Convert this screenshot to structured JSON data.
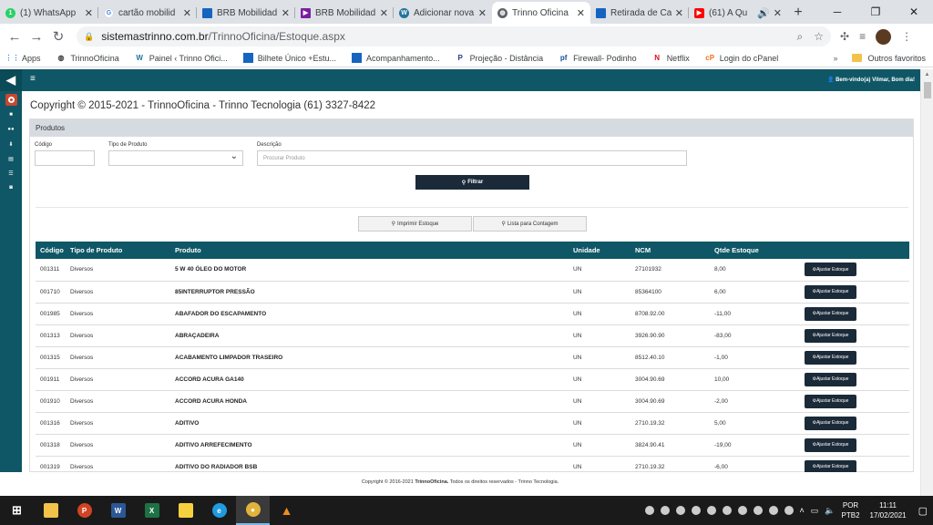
{
  "browser": {
    "tabs": [
      {
        "title": "(1) WhatsApp",
        "icon": "whatsapp-icon",
        "color": "#25d366"
      },
      {
        "title": "cartão mobilid",
        "icon": "google-icon",
        "color": "#4285f4"
      },
      {
        "title": "BRB Mobilidad",
        "icon": "brb-icon",
        "color": "#1565c0"
      },
      {
        "title": "BRB Mobilidad",
        "icon": "play-icon",
        "color": "#7b1fa2"
      },
      {
        "title": "Adicionar nova",
        "icon": "wordpress-icon",
        "color": "#21759b"
      },
      {
        "title": "Trinno Oficina",
        "icon": "globe-icon",
        "color": "#5f6368",
        "active": true
      },
      {
        "title": "Retirada de Ca",
        "icon": "brb-icon",
        "color": "#1565c0"
      },
      {
        "title": "(61) A Qu",
        "icon": "youtube-icon",
        "color": "#ff0000"
      }
    ],
    "url": {
      "host": "sistemastrinno.com.br",
      "path": "/TrinnoOficina/Estoque.aspx"
    },
    "bookmarks": [
      {
        "label": "Apps",
        "icon": "apps-grid-icon"
      },
      {
        "label": "TrinnoOficina",
        "icon": "globe-icon"
      },
      {
        "label": "Painel ‹ Trinno Ofici...",
        "icon": "wordpress-icon"
      },
      {
        "label": "Bilhete Único +Estu...",
        "icon": "brb-icon"
      },
      {
        "label": "Acompanhamento...",
        "icon": "brb-icon"
      },
      {
        "label": "Projeção - Distância",
        "icon": "p-icon"
      },
      {
        "label": "Firewall- Podinho",
        "icon": "pf-icon"
      },
      {
        "label": "Netflix",
        "icon": "netflix-icon"
      },
      {
        "label": "Login do cPanel",
        "icon": "cpanel-icon"
      }
    ],
    "other_bookmarks": "Outros favoritos"
  },
  "header": {
    "welcome": "Bem-vindo(a) Vilmar, Bom dia!"
  },
  "page": {
    "copyright": "Copyright © 2015-2021 - TrinnoOficina - Trinno Tecnologia (61) 3327-8422",
    "panel_title": "Produtos",
    "filters": {
      "codigo_label": "Código",
      "tipo_label": "Tipo de Produto",
      "descricao_label": "Descrição",
      "descricao_placeholder": "Procurar Produto",
      "filter_button": "Filtrar"
    },
    "buttons": {
      "print": "Imprimir Estoque",
      "count_list": "Lista para Contagem"
    },
    "table": {
      "headers": [
        "Código",
        "Tipo de Produto",
        "Produto",
        "Unidade",
        "NCM",
        "Qtde Estoque"
      ],
      "adjust_label": "Ajustar Estoque",
      "rows": [
        {
          "codigo": "001311",
          "tipo": "Diversos",
          "produto": "5 W 40 ÓLEO DO MOTOR",
          "unidade": "UN",
          "ncm": "27101932",
          "qtde": "8,00"
        },
        {
          "codigo": "001710",
          "tipo": "Diversos",
          "produto": "85INTERRUPTOR PRESSÃO",
          "unidade": "UN",
          "ncm": "85364100",
          "qtde": "6,00"
        },
        {
          "codigo": "001985",
          "tipo": "Diversos",
          "produto": "ABAFADOR DO ESCAPAMENTO",
          "unidade": "UN",
          "ncm": "8708.92.00",
          "qtde": "-11,00"
        },
        {
          "codigo": "001313",
          "tipo": "Diversos",
          "produto": "ABRAÇADEIRA",
          "unidade": "UN",
          "ncm": "3926.90.90",
          "qtde": "-83,00"
        },
        {
          "codigo": "001315",
          "tipo": "Diversos",
          "produto": "ACABAMENTO LIMPADOR TRASEIRO",
          "unidade": "UN",
          "ncm": "8512.40.10",
          "qtde": "-1,00"
        },
        {
          "codigo": "001911",
          "tipo": "Diversos",
          "produto": "ACCORD ACURA GA140",
          "unidade": "UN",
          "ncm": "3004.90.69",
          "qtde": "10,00"
        },
        {
          "codigo": "001910",
          "tipo": "Diversos",
          "produto": "ACCORD ACURA HONDA",
          "unidade": "UN",
          "ncm": "3004.90.69",
          "qtde": "-2,00"
        },
        {
          "codigo": "001316",
          "tipo": "Diversos",
          "produto": "ADITIVO",
          "unidade": "UN",
          "ncm": "2710.19.32",
          "qtde": "5,00"
        },
        {
          "codigo": "001318",
          "tipo": "Diversos",
          "produto": "ADITIVO ARREFECIMENTO",
          "unidade": "UN",
          "ncm": "3824.90.41",
          "qtde": "-19,00"
        },
        {
          "codigo": "001319",
          "tipo": "Diversos",
          "produto": "ADITIVO DO RADIADOR BSB",
          "unidade": "UN",
          "ncm": "2710.19.32",
          "qtde": "-6,00"
        }
      ]
    },
    "footer": {
      "prefix": "Copyright © 2016-2021",
      "brand": "TrinnoOficina.",
      "suffix": "Todos os direitos reservados - Trinno Tecnologia."
    }
  },
  "taskbar": {
    "apps": [
      {
        "name": "windows-start-icon",
        "color": "#ffffff"
      },
      {
        "name": "file-explorer-icon",
        "color": "#f2c24b"
      },
      {
        "name": "powerpoint-icon",
        "color": "#d04423"
      },
      {
        "name": "word-icon",
        "color": "#2b5797"
      },
      {
        "name": "excel-icon",
        "color": "#1e7145"
      },
      {
        "name": "sticky-notes-icon",
        "color": "#f7d13d"
      },
      {
        "name": "edge-icon",
        "color": "#1f9be0"
      },
      {
        "name": "chrome-icon",
        "color": "#e0b33a"
      },
      {
        "name": "vlc-icon",
        "color": "#f08c1c"
      }
    ],
    "lang": {
      "line1": "POR",
      "line2": "PTB2"
    },
    "clock": {
      "time": "11:11",
      "date": "17/02/2021"
    }
  }
}
